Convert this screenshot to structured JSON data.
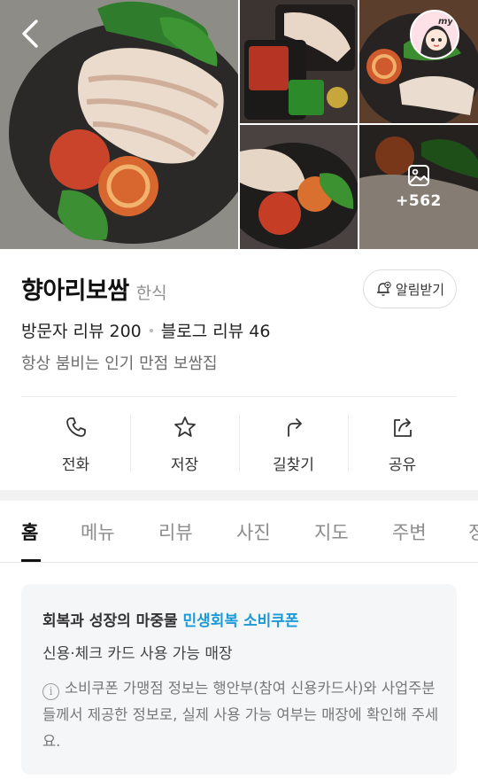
{
  "gallery": {
    "more_photos_count": "+562",
    "avatar_label": "my"
  },
  "place": {
    "name": "향아리보쌈",
    "category": "한식",
    "notification_label": "알림받기",
    "visitor_reviews": "방문자 리뷰 200",
    "blog_reviews": "블로그 리뷰 46",
    "description": "항상 붐비는 인기 만점 보쌈집"
  },
  "actions": [
    {
      "label": "전화",
      "icon": "phone-icon"
    },
    {
      "label": "저장",
      "icon": "star-icon"
    },
    {
      "label": "길찾기",
      "icon": "directions-icon"
    },
    {
      "label": "공유",
      "icon": "share-icon"
    }
  ],
  "tabs": [
    {
      "label": "홈",
      "active": true
    },
    {
      "label": "메뉴"
    },
    {
      "label": "리뷰"
    },
    {
      "label": "사진"
    },
    {
      "label": "지도"
    },
    {
      "label": "주변"
    },
    {
      "label": "정"
    }
  ],
  "coupon": {
    "title_prefix": "회복과 성장의 마중물",
    "title_accent": "민생회복 소비쿠폰",
    "subtitle": "신용·체크 카드 사용 가능 매장",
    "notice": "소비쿠폰 가맹점 정보는 행안부(참여 신용카드사)와 사업주분들께서 제공한 정보로, 실제 사용 가능 여부는 매장에 확인해 주세요."
  },
  "colors": {
    "accent": "#1c9ad6",
    "text": "#222222",
    "muted": "#8c8c8c"
  }
}
